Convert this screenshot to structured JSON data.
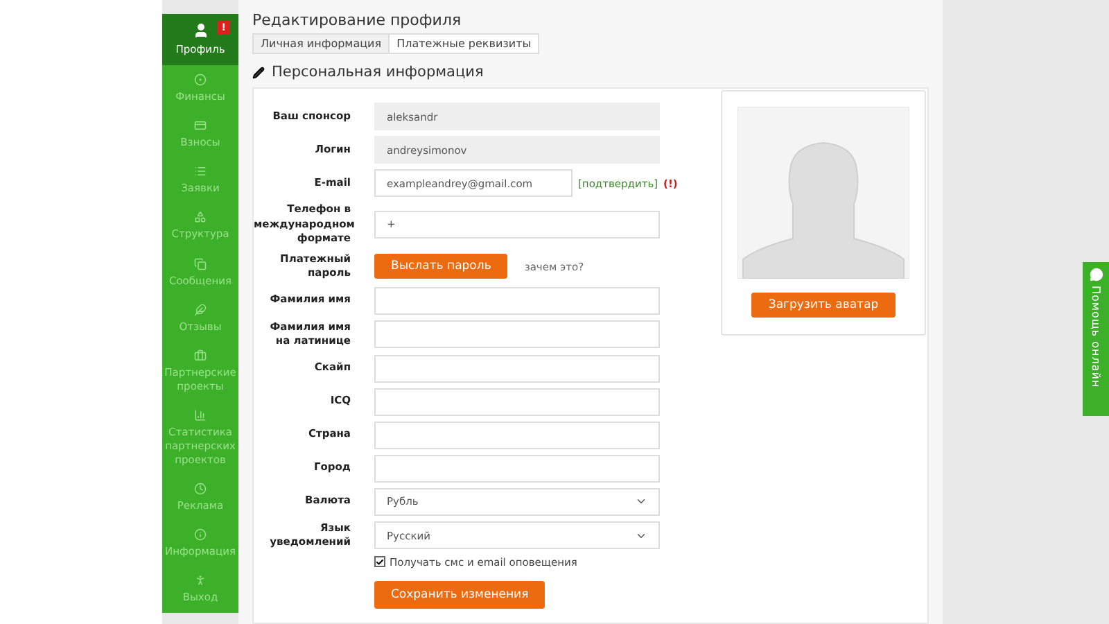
{
  "sidebar": {
    "items": [
      {
        "label": "Профиль",
        "selected": true,
        "badge": "!"
      },
      {
        "label": "Финансы",
        "selected": false
      },
      {
        "label": "Взносы",
        "selected": false
      },
      {
        "label": "Заявки",
        "selected": false
      },
      {
        "label": "Структура",
        "selected": false
      },
      {
        "label": "Сообщения",
        "selected": false
      },
      {
        "label": "Отзывы",
        "selected": false
      },
      {
        "label": "Партнерские проекты",
        "selected": false
      },
      {
        "label": "Статистика партнерских проектов",
        "selected": false
      },
      {
        "label": "Реклама",
        "selected": false
      },
      {
        "label": "Информация",
        "selected": false
      },
      {
        "label": "Выход",
        "selected": false
      }
    ]
  },
  "page_title": "Редактирование профиля",
  "tabs": [
    {
      "label": "Личная информация",
      "selected": true
    },
    {
      "label": "Платежные реквизиты",
      "selected": false
    }
  ],
  "section_title": "Персональная информация",
  "form": {
    "fields": [
      {
        "kind": "readonly",
        "label": "Ваш спонсор",
        "value": "aleksandr"
      },
      {
        "kind": "readonly",
        "label": "Логин",
        "value": "andreysimonov"
      },
      {
        "kind": "email",
        "label": "E-mail",
        "value": "exampleandrey@gmail.com",
        "confirm_link": "[подтвердить]",
        "warning": "(!)"
      },
      {
        "kind": "text",
        "label": "Телефон в международном формате",
        "value": "+"
      },
      {
        "kind": "button",
        "label": "Платежный пароль",
        "button": "Выслать пароль",
        "link": "зачем это?"
      },
      {
        "kind": "text",
        "label": "Фамилия имя"
      },
      {
        "kind": "text",
        "label": "Фамилия имя на латинице"
      },
      {
        "kind": "text",
        "label": "Скайп"
      },
      {
        "kind": "text",
        "label": "ICQ"
      },
      {
        "kind": "text",
        "label": "Страна"
      },
      {
        "kind": "text",
        "label": "Город"
      },
      {
        "kind": "select",
        "label": "Валюта",
        "value": "Рубль"
      },
      {
        "kind": "select",
        "label": "Язык уведомлений",
        "value": "Русский"
      }
    ],
    "notify_checkbox": {
      "label": "Получать смс и email оповещения",
      "checked": true
    },
    "save_button": "Сохранить изменения"
  },
  "avatar": {
    "upload_button": "Загрузить аватар"
  },
  "help_tab": {
    "label": "Помощь онлайн"
  }
}
